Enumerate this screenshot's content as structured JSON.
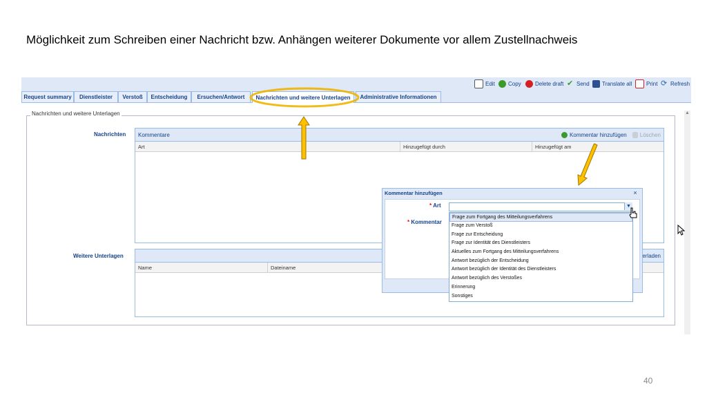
{
  "slide": {
    "title": "Möglichkeit zum Schreiben einer Nachricht bzw. Anhängen weiterer Dokumente vor allem Zustellnachweis",
    "page_number": "40"
  },
  "toolbar": {
    "edit": "Edit",
    "copy": "Copy",
    "delete_draft": "Delete draft",
    "send": "Send",
    "translate_all": "Translate all",
    "print": "Print",
    "refresh": "Refresh"
  },
  "tabs": [
    {
      "label": "Request summary"
    },
    {
      "label": "Dienstleister"
    },
    {
      "label": "Verstoß"
    },
    {
      "label": "Entscheidung"
    },
    {
      "label": "Ersuchen/Antwort"
    },
    {
      "label": "Nachrichten und weitere Unterlagen",
      "active": true
    },
    {
      "label": "Administrative Informationen"
    }
  ],
  "panel": {
    "legend": "Nachrichten und weitere Unterlagen",
    "nachrichten": {
      "label": "Nachrichten",
      "grid_title": "Kommentare",
      "add_button": "Kommentar hinzufügen",
      "delete_button": "Löschen",
      "columns": [
        "Art",
        "Hinzugefügt durch",
        "Hinzugefügt am"
      ]
    },
    "unterlagen": {
      "label": "Weitere Unterlagen",
      "columns": [
        "Name",
        "Dateiname"
      ],
      "partial_button": "erladen"
    }
  },
  "dialog": {
    "title": "Kommentar hinzufügen",
    "close": "×",
    "art_label": "Art",
    "kommentar_label": "Kommentar",
    "required_mark": "*",
    "options": [
      "Frage zum Fortgang des Mitteilungsverfahrens",
      "Frage zum Verstoß",
      "Frage zur Entscheidung",
      "Frage zur Identität des Dienstleisters",
      "Aktuelles zum Fortgang des Mitteilungsverfahrens",
      "Antwort bezüglich der Entscheidung",
      "Antwort bezüglich der Identität des Dienstleisters",
      "Antwort bezüglich des Verstoßes",
      "Erinnerung",
      "Sonstiges"
    ],
    "highlighted_option_index": 0
  },
  "colors": {
    "accent": "#15428b",
    "header_bg": "#dfe8f6",
    "border": "#99bbe8",
    "highlight_ellipse": "#f0b400",
    "arrow": "#ffc000"
  }
}
